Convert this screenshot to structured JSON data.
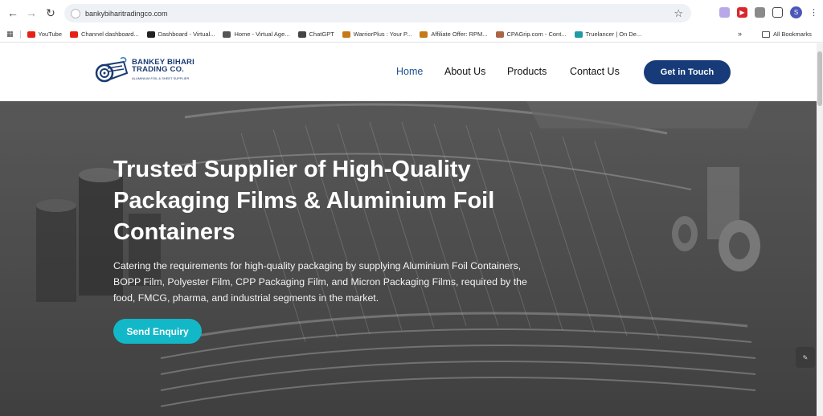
{
  "browser": {
    "url": "bankybiharitradingco.com",
    "bookmarks": [
      {
        "label": "YouTube",
        "color": "#e62117"
      },
      {
        "label": "Channel dashboard...",
        "color": "#e62117"
      },
      {
        "label": "Dashboard - Virtual...",
        "color": "#222222"
      },
      {
        "label": "Home - Virtual Age...",
        "color": "#555555"
      },
      {
        "label": "ChatGPT",
        "color": "#444444"
      },
      {
        "label": "WarriorPlus : Your P...",
        "color": "#c67a17"
      },
      {
        "label": "Affiliate Offer: RPM...",
        "color": "#c67a17"
      },
      {
        "label": "CPAGrip.com - Cont...",
        "color": "#aa6644"
      },
      {
        "label": "Truelancer | On De...",
        "color": "#1f9aa6"
      }
    ],
    "all_bookmarks": "All Bookmarks",
    "profile_initial": "S"
  },
  "site": {
    "logo": {
      "name_line1": "BANKEY BIHARI",
      "name_line2": "TRADING CO.",
      "tagline": "ALUMINIUM FOIL & SHEET SUPPLIER"
    },
    "nav": {
      "home": "Home",
      "about": "About Us",
      "products": "Products",
      "contact": "Contact Us"
    },
    "cta": "Get in Touch",
    "hero": {
      "title": "Trusted Supplier of High-Quality Packaging Films & Aluminium Foil Containers",
      "description": "Catering the requirements for high-quality packaging by supplying Aluminium Foil Containers, BOPP Film, Polyester Film, CPP Packaging Film, and Micron Packaging Films, required by the food, FMCG, pharma, and industrial segments in the market.",
      "button": "Send Enquiry"
    }
  },
  "colors": {
    "brand_navy": "#163b78",
    "nav_active": "#1d4f91",
    "hero_button": "#13b8c8"
  }
}
